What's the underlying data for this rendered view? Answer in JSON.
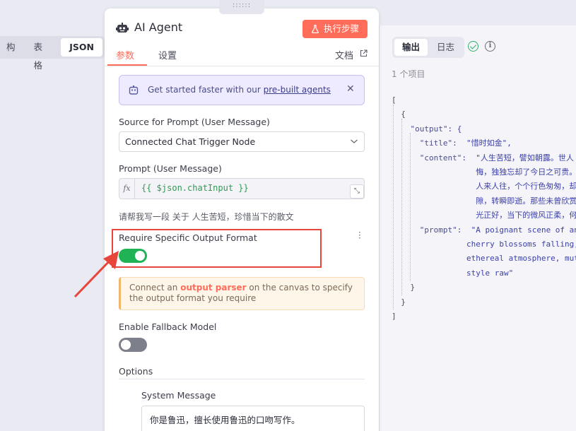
{
  "left_pane": {
    "tabs": [
      {
        "label": "构",
        "active": false
      },
      {
        "label": "表格",
        "active": false
      },
      {
        "label": "JSON",
        "active": true
      }
    ]
  },
  "panel": {
    "drag_handle": "::::::",
    "title": "AI Agent",
    "title_icon": "robot-icon",
    "exec_button": "执行步骤",
    "exec_button_icon": "flask-icon",
    "tabs": {
      "params": "参数",
      "settings": "设置"
    },
    "docs_link": "文档",
    "accent_color": "#ff6d5a"
  },
  "callout": {
    "prefix": "Get started faster with our ",
    "link": "pre-built agents",
    "close": "✕"
  },
  "prompt_source": {
    "label": "Source for Prompt (User Message)",
    "value": "Connected Chat Trigger Node"
  },
  "prompt": {
    "label": "Prompt (User Message)",
    "fx": "fx",
    "expression": "{{ $json.chatInput }}",
    "hint": "请帮我写一段 关于 人生苦短，珍惜当下的散文"
  },
  "output_format": {
    "label": "Require Specific Output Format",
    "enabled": true,
    "warning_prefix": "Connect an ",
    "warning_link": "output parser",
    "warning_suffix": " on the canvas to specify the output format you require"
  },
  "fallback": {
    "label": "Enable Fallback Model",
    "enabled": false
  },
  "options": {
    "label": "Options",
    "system_message_label": "System Message",
    "system_message_value": "你是鲁迅，擅长使用鲁迅的口吻写作。"
  },
  "output_pane": {
    "tabs": [
      {
        "label": "输出",
        "active": true
      },
      {
        "label": "日志",
        "active": false
      }
    ],
    "item_count": "1 个项目",
    "json_lines": [
      {
        "indent": 0,
        "text": "["
      },
      {
        "indent": 1,
        "text": "{"
      },
      {
        "indent": 2,
        "key": "\"output\"",
        "text": ": {"
      },
      {
        "indent": 3,
        "key": "\"title\"",
        "text": ":  \"惜时如金\","
      },
      {
        "indent": 3,
        "key": "\"content\"",
        "text": ":  \"人生苦短，譬如朝露。世人"
      },
      {
        "indent": 9,
        "text": "悔，独独忘却了今日之可贵。"
      },
      {
        "indent": 9,
        "text": "人来人往，个个行色匆匆，却"
      },
      {
        "indent": 9,
        "text": "隙，转瞬即逝。那些未曾欣赏"
      },
      {
        "indent": 9,
        "text": "光正好，当下的微风正柔，何"
      },
      {
        "indent": 3,
        "key": "\"prompt\"",
        "text": ":  \"A poignant scene of an"
      },
      {
        "indent": 8,
        "text": "cherry blossoms falling,"
      },
      {
        "indent": 8,
        "text": "ethereal atmosphere, mute"
      },
      {
        "indent": 8,
        "text": "style raw\""
      },
      {
        "indent": 2,
        "text": "}"
      },
      {
        "indent": 1,
        "text": "}"
      },
      {
        "indent": 0,
        "text": "]"
      }
    ]
  }
}
